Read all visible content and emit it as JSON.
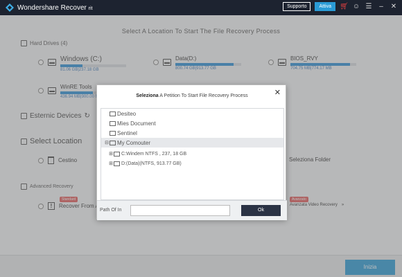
{
  "app": {
    "title": "Wondershare Recover",
    "title_suffix": "rit"
  },
  "titlebar": {
    "support_label": "Supporto",
    "activate_label": "Attiva",
    "icons": [
      "cart-icon",
      "user-icon",
      "menu-icon",
      "minimize-icon",
      "close-icon"
    ]
  },
  "main": {
    "title": "Select A Location To Start The File Recovery Process",
    "hard_drives_label": "Hard Drives (4)",
    "drives": [
      {
        "name": "Windows (C:)",
        "size": "81.06 GB|237.18 GB",
        "fill": 0.34
      },
      {
        "name": "Data(D:)",
        "size": "800.74 GB|913.77 GB",
        "fill": 0.88
      },
      {
        "name": "BIOS_RVY",
        "size": "704.75 MB|774.17 MB",
        "fill": 0.91
      },
      {
        "name": "WinRE Tools",
        "size": "436.94 MB|900.00 MB",
        "fill": 0.49
      }
    ],
    "external_label": "Esternic Devices",
    "select_location_label": "Select Location",
    "recycle_label": "Cestino",
    "select_folder_label": "Seleziona Folder",
    "advanced_label": "Advanced Recovery",
    "advanced": [
      {
        "label": "Recover From A Co",
        "badge": "Standard"
      },
      {
        "label": "Avanzata Video Recovery",
        "badge": "Avanzato"
      }
    ]
  },
  "bottom": {
    "start_label": "Inizia"
  },
  "dialog": {
    "title_bold": "Seleziona",
    "title_rest": "A Petition To Start File Recovery Process",
    "tree": [
      {
        "label": "Desiteo",
        "indent": 0,
        "expander": "",
        "selected": false
      },
      {
        "label": "Mies Document",
        "indent": 0,
        "expander": "",
        "selected": false
      },
      {
        "label": "Sentinel",
        "indent": 0,
        "expander": "",
        "selected": false
      },
      {
        "label": "My Comouter",
        "indent": 0,
        "expander": "⊟",
        "selected": true
      },
      {
        "label": "C:Windem NTFS , 237, 18 GB",
        "indent": 1,
        "expander": "⊞",
        "selected": false
      },
      {
        "label": "D:(Data)(NTFS, 913.77 GB)",
        "indent": 1,
        "expander": "⊞",
        "selected": false
      }
    ],
    "path_label": "Path Of In",
    "path_value": "",
    "ok_label": "Ok"
  }
}
